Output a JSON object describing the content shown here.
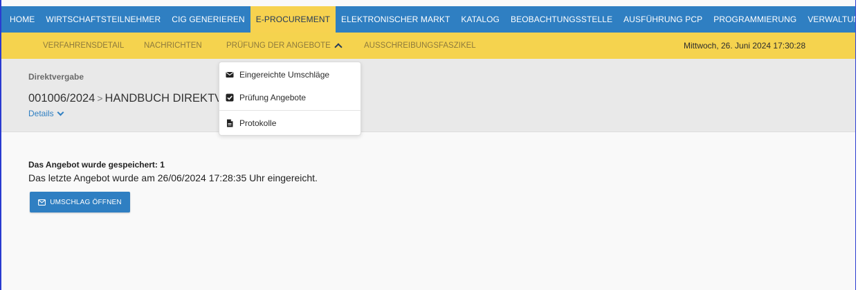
{
  "top_nav": {
    "items": [
      {
        "label": "HOME"
      },
      {
        "label": "WIRTSCHAFTSTEILNEHMER"
      },
      {
        "label": "CIG GENERIEREN"
      },
      {
        "label": "E-PROCUREMENT",
        "active": true
      },
      {
        "label": "ELEKTRONISCHER MARKT"
      },
      {
        "label": "KATALOG"
      },
      {
        "label": "BEOBACHTUNGSSTELLE"
      },
      {
        "label": "AUSFÜHRUNG PCP"
      },
      {
        "label": "PROGRAMMIERUNG"
      },
      {
        "label": "VERWALTUNG"
      }
    ]
  },
  "sub_nav": {
    "items": [
      {
        "label": "VERFAHRENSDETAIL"
      },
      {
        "label": "NACHRICHTEN"
      },
      {
        "label": "PRÜFUNG DER ANGEBOTE",
        "expanded": true
      },
      {
        "label": "AUSSCHREIBUNGSFASZIKEL"
      }
    ],
    "datetime": "Mittwoch, 26. Juni 2024 17:30:28"
  },
  "header": {
    "procedure_type": "Direktvergabe",
    "procedure_number": "001006/2024",
    "procedure_name": "HANDBUCH DIREKTV",
    "details_label": "Details"
  },
  "dropdown": {
    "items": [
      {
        "label": "Eingereichte Umschläge",
        "icon": "envelope-icon"
      },
      {
        "label": "Prüfung Angebote",
        "icon": "checkbox-icon"
      },
      {
        "label": "Protokolle",
        "icon": "document-icon"
      }
    ]
  },
  "content": {
    "saved_message": "Das Angebot wurde gespeichert: 1",
    "submitted_message": "Das letzte Angebot wurde am 26/06/2024 17:28:35 Uhr eingereicht.",
    "open_button_label": "UMSCHLAG ÖFFNEN"
  },
  "colors": {
    "primary_blue": "#2f7fc2",
    "accent_yellow": "#f5d34e"
  }
}
